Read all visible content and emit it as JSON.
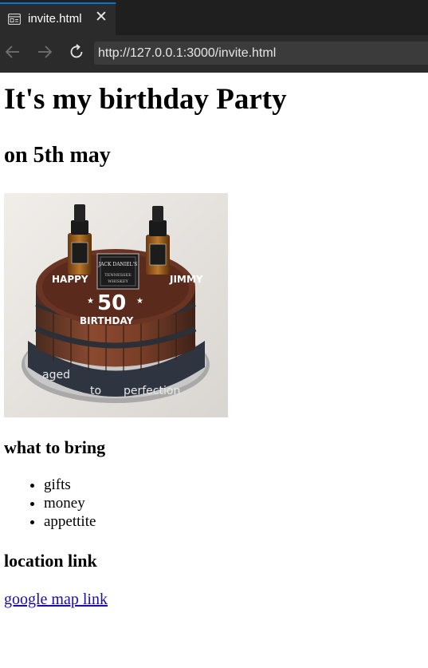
{
  "browser": {
    "tab": {
      "title": "invite.html",
      "icon": "page-icon"
    },
    "url": "http://127.0.0.1:3000/invite.html",
    "colors": {
      "chrome": "#1f1f1f",
      "toolbar": "#2b2b2b",
      "accent": "#0078d4"
    }
  },
  "page": {
    "heading": "It's my birthday Party",
    "subheading": "on 5th may",
    "image": {
      "cake_text": {
        "top": "HAPPY",
        "right": "JIMMY",
        "number": "50",
        "bottom": "BIRTHDAY",
        "banner": "aged to perfection",
        "label": "Jack Daniel's"
      }
    },
    "bring_heading": "what to bring",
    "bring_items": [
      "gifts",
      "money",
      "appettite"
    ],
    "location_heading": "location link",
    "location_link": "google map link"
  }
}
